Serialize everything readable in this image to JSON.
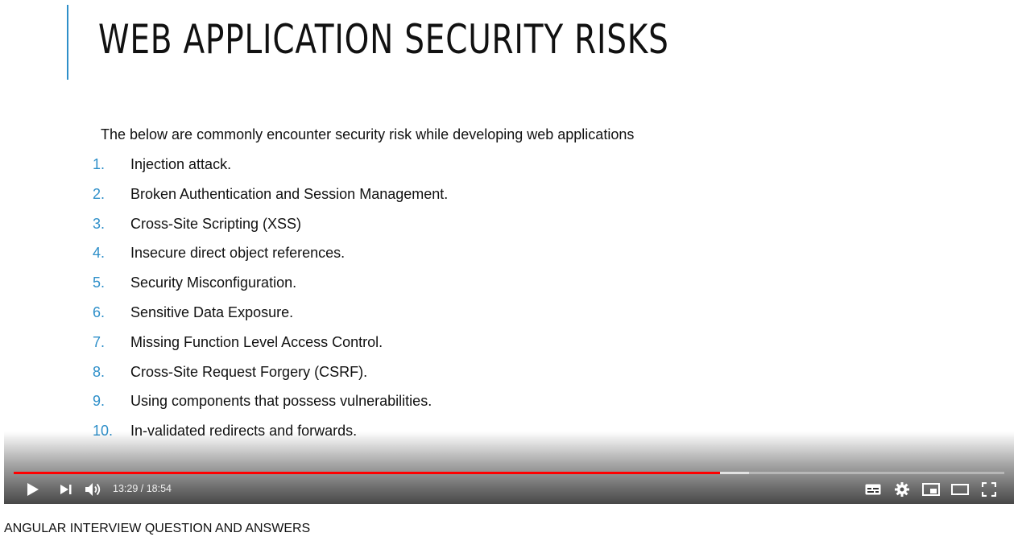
{
  "slide": {
    "title": "WEB APPLICATION SECURITY RISKS",
    "intro": "The below are commonly encounter security risk while developing web applications",
    "items": [
      {
        "num": "1.",
        "text": "Injection attack."
      },
      {
        "num": "2.",
        "text": "Broken Authentication and Session Management."
      },
      {
        "num": "3.",
        "text": "Cross-Site Scripting (XSS)"
      },
      {
        "num": "4.",
        "text": "Insecure direct object references."
      },
      {
        "num": "5.",
        "text": "Security Misconfiguration."
      },
      {
        "num": "6.",
        "text": "Sensitive Data Exposure."
      },
      {
        "num": "7.",
        "text": "Missing Function Level Access Control."
      },
      {
        "num": "8.",
        "text": "Cross-Site Request Forgery (CSRF)."
      },
      {
        "num": "9.",
        "text": "Using components that possess vulnerabilities."
      },
      {
        "num": "10.",
        "text": "In-validated redirects and forwards."
      }
    ]
  },
  "player": {
    "current_time": "13:29",
    "separator": " / ",
    "duration": "18:54",
    "played_fraction": 0.713,
    "buffered_fraction": 0.742,
    "progress_color": "#ff0000",
    "accent_color": "#2e8fc9",
    "icons": {
      "play": "play-icon",
      "next": "next-icon",
      "volume": "volume-icon",
      "subtitles": "subtitles-icon",
      "settings": "gear-icon",
      "miniplayer": "miniplayer-icon",
      "theater": "theater-mode-icon",
      "fullscreen": "fullscreen-icon"
    }
  },
  "video": {
    "title": "ANGULAR INTERVIEW QUESTION AND ANSWERS"
  }
}
